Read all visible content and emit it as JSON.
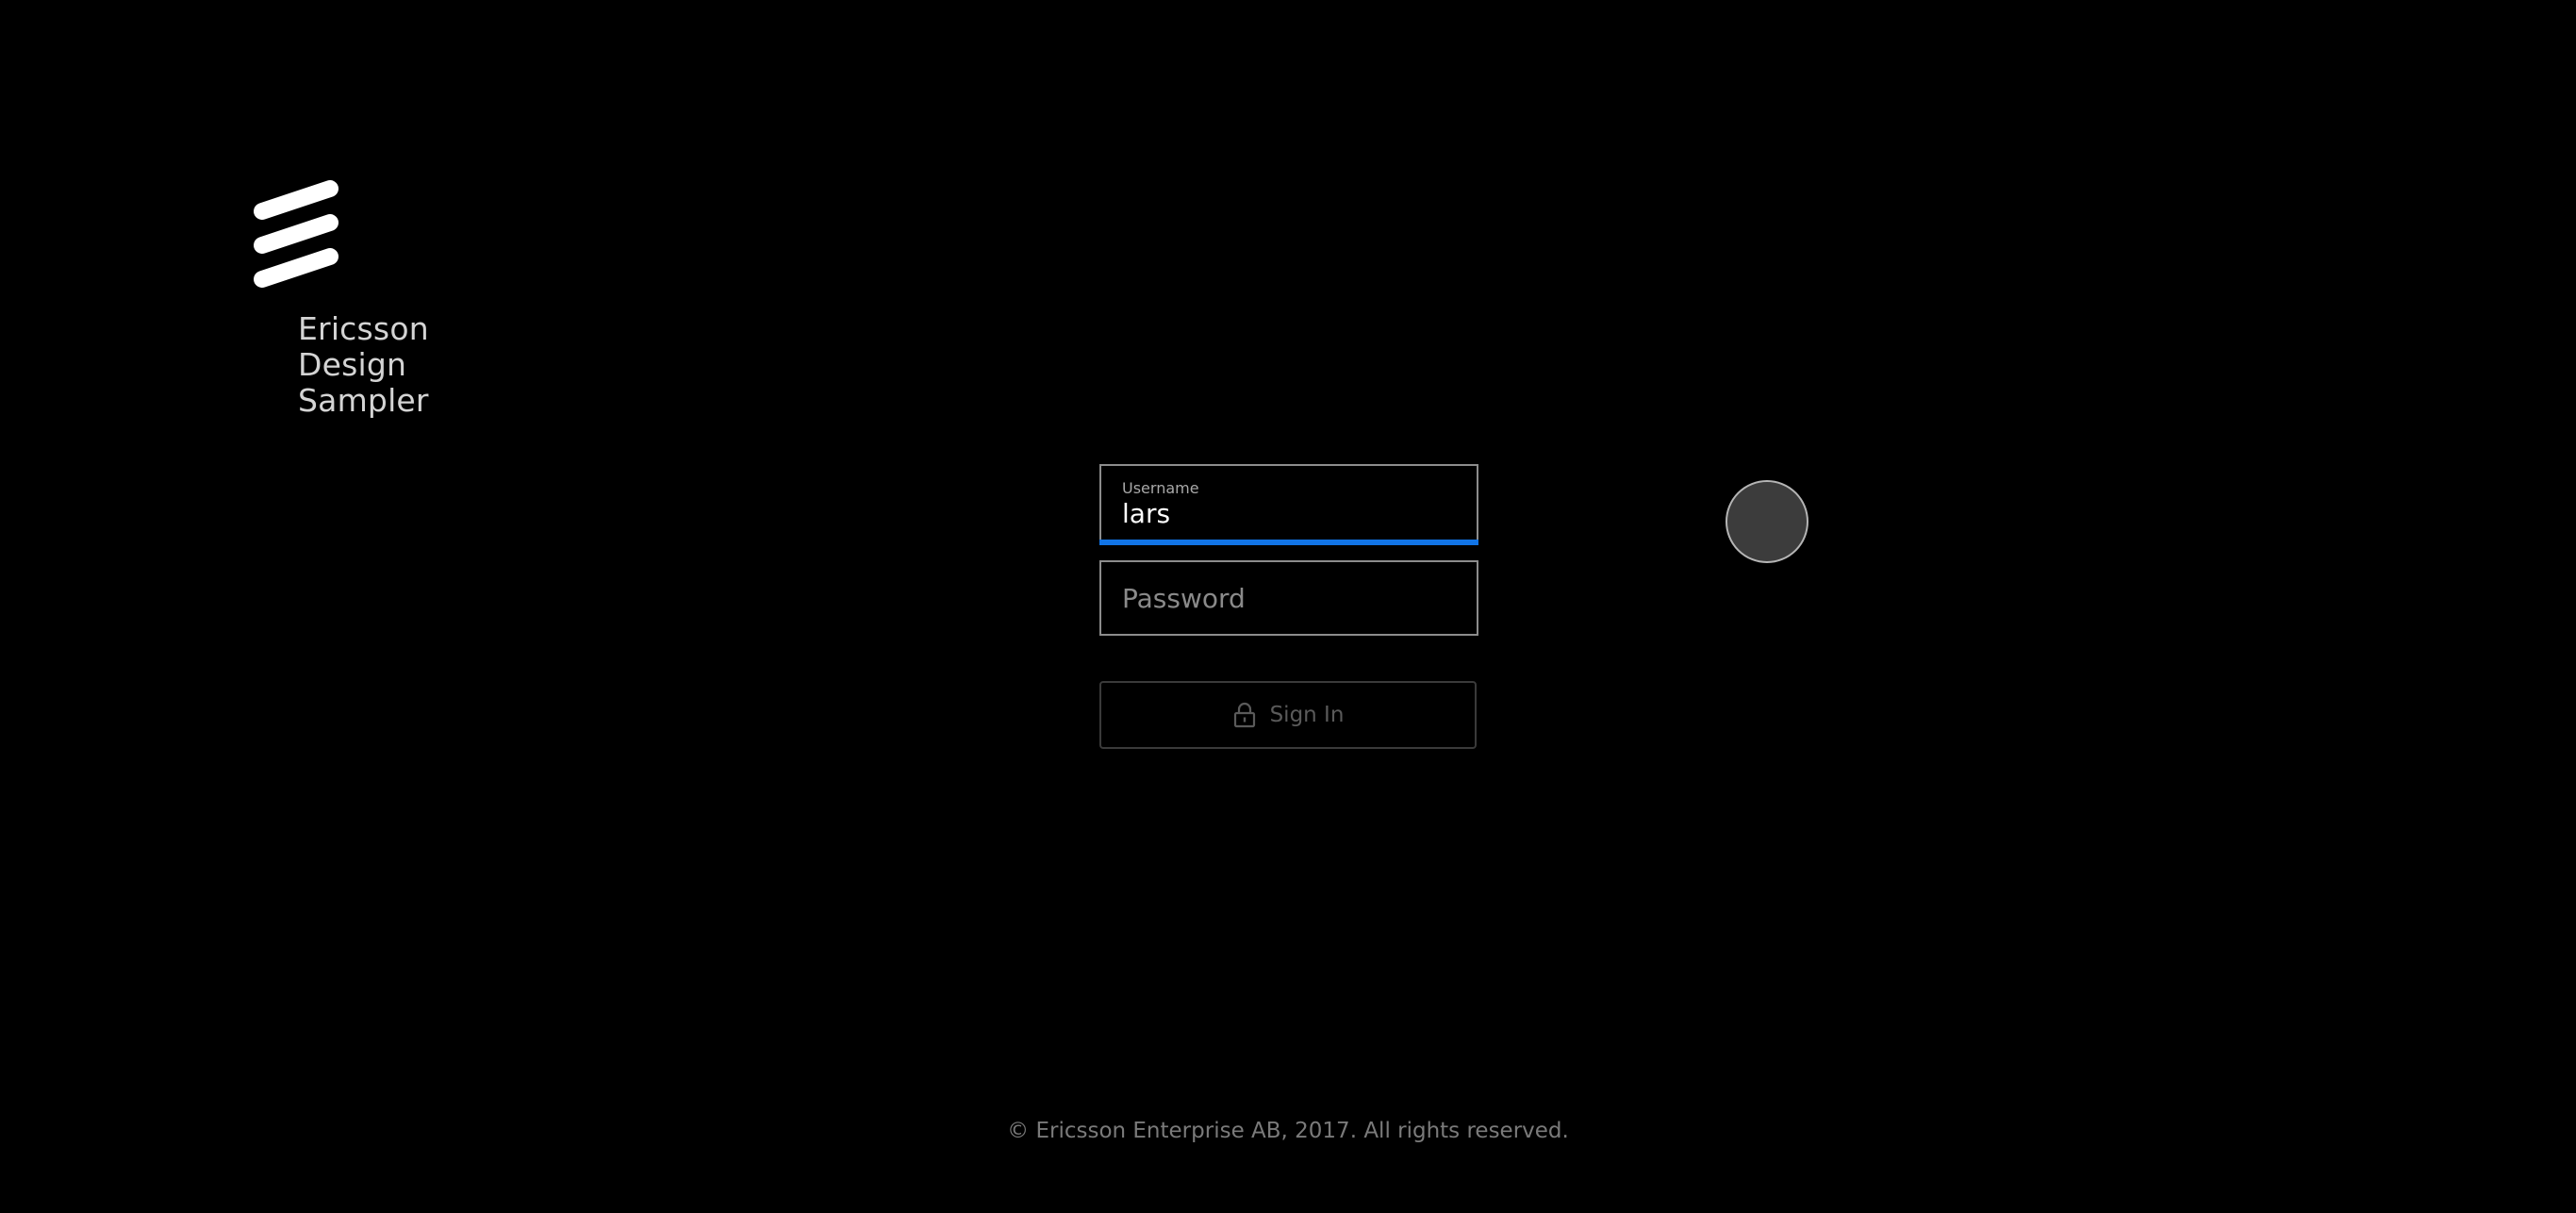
{
  "brand": {
    "logo_icon": "ericsson-logo-icon",
    "name_lines": [
      "Ericsson",
      "Design",
      "Sampler"
    ]
  },
  "login": {
    "username": {
      "label": "Username",
      "value": "lars"
    },
    "password": {
      "placeholder": "Password"
    },
    "signin": {
      "label": "Sign In",
      "icon": "lock-icon"
    }
  },
  "colors": {
    "background": "#000000",
    "accent": "#1174e6",
    "text": "#ffffff",
    "muted": "#7a7a7a"
  },
  "footer": {
    "copyright": "© Ericsson Enterprise AB, 2017. All rights reserved."
  }
}
